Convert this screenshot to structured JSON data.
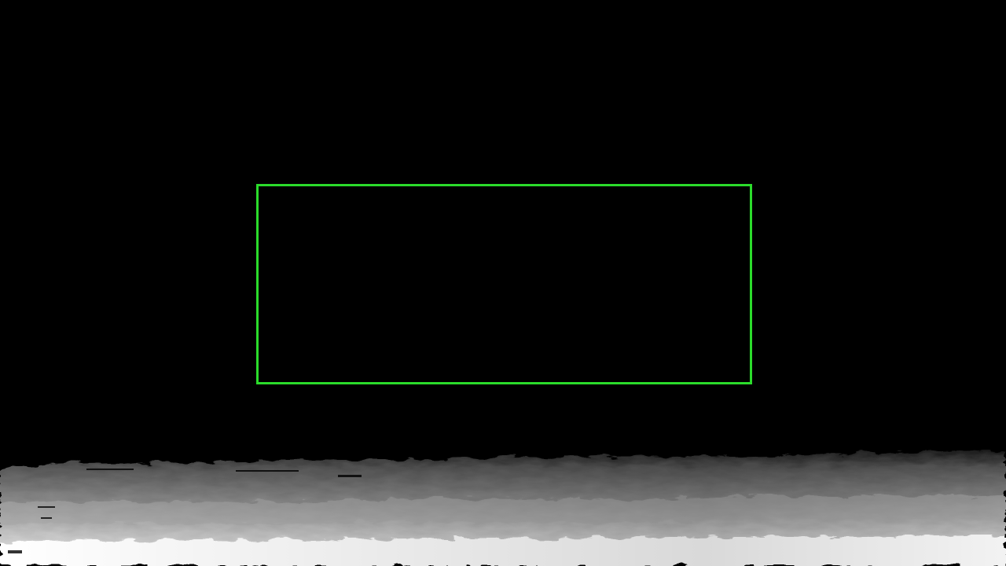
{
  "scene": {
    "background_color": "#000000",
    "depth_map_colors": {
      "far": "#000000",
      "mid": "#8c8c8c",
      "near": "#ffffff"
    }
  },
  "overlay": {
    "box_color": "#2bdc2b"
  }
}
